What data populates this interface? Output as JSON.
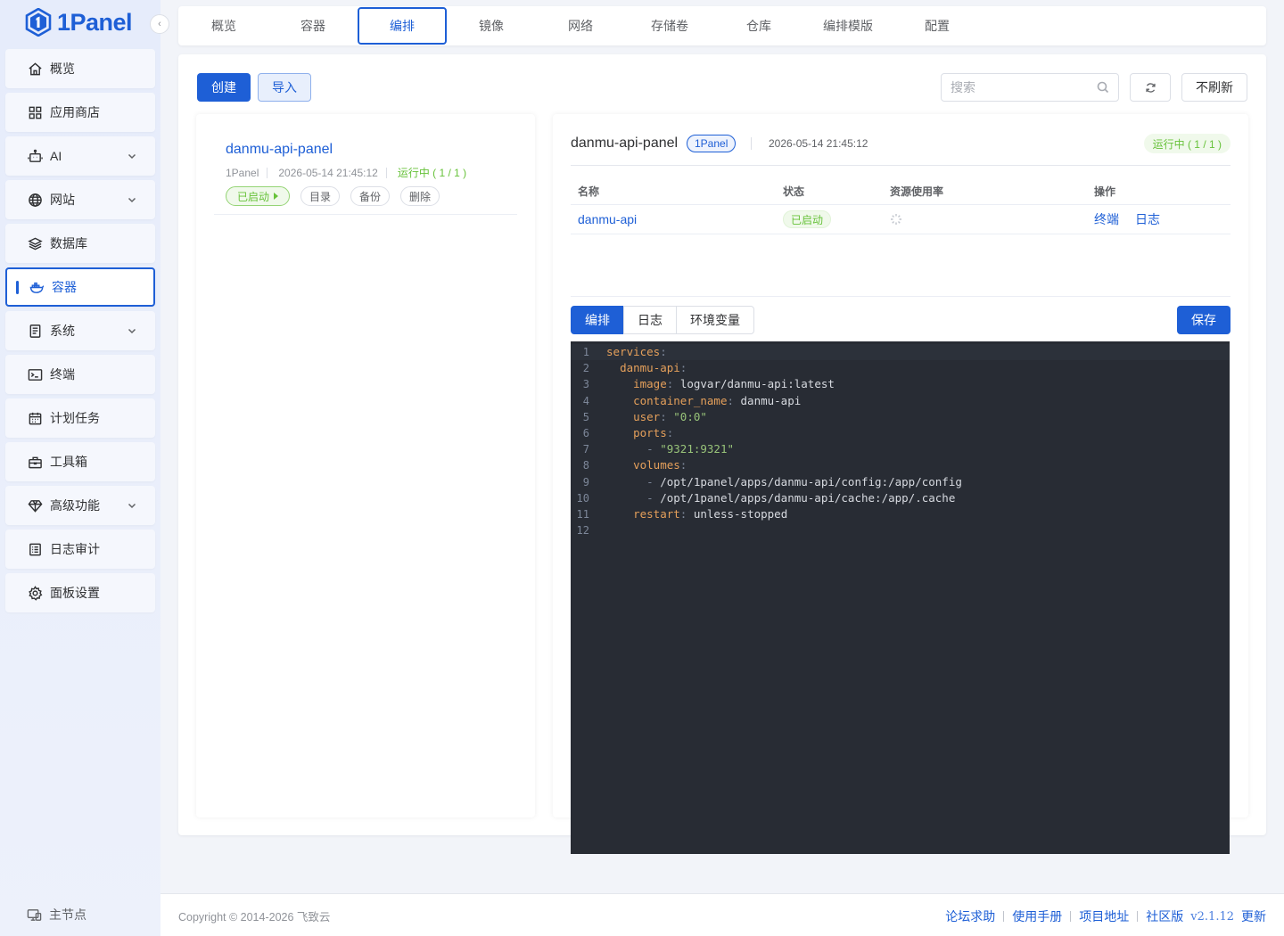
{
  "app": {
    "logo_text": "1Panel"
  },
  "sidebar": {
    "items": [
      {
        "label": "概览",
        "icon": "home-icon"
      },
      {
        "label": "应用商店",
        "icon": "grid-icon"
      },
      {
        "label": "AI",
        "icon": "robot-icon"
      },
      {
        "label": "网站",
        "icon": "globe-icon"
      },
      {
        "label": "数据库",
        "icon": "layers-icon"
      },
      {
        "label": "容器",
        "icon": "docker-icon"
      },
      {
        "label": "系统",
        "icon": "document-icon"
      },
      {
        "label": "终端",
        "icon": "terminal-icon"
      },
      {
        "label": "计划任务",
        "icon": "calendar-icon"
      },
      {
        "label": "工具箱",
        "icon": "toolbox-icon"
      },
      {
        "label": "高级功能",
        "icon": "diamond-icon"
      },
      {
        "label": "日志审计",
        "icon": "log-icon"
      },
      {
        "label": "面板设置",
        "icon": "gear-icon"
      }
    ],
    "footer_label": "主节点"
  },
  "top_tabs": [
    "概览",
    "容器",
    "编排",
    "镜像",
    "网络",
    "存储卷",
    "仓库",
    "编排模版",
    "配置"
  ],
  "toolbar": {
    "create_label": "创建",
    "import_label": "导入",
    "search_placeholder": "搜索",
    "no_refresh_label": "不刷新"
  },
  "project": {
    "name": "danmu-api-panel",
    "source": "1Panel",
    "created": "2026-05-14 21:45:12",
    "status": "运行中 ( 1 / 1 )",
    "actions": {
      "started": "已启动",
      "directory": "目录",
      "backup": "备份",
      "delete": "删除"
    }
  },
  "detail": {
    "title": "danmu-api-panel",
    "badge": "1Panel",
    "time": "2026-05-14 21:45:12",
    "status": "运行中 ( 1 / 1 )",
    "table": {
      "headers": [
        "名称",
        "状态",
        "资源使用率",
        "操作"
      ],
      "rows": [
        {
          "name": "danmu-api",
          "status": "已启动",
          "ops": [
            "终端",
            "日志"
          ]
        }
      ]
    },
    "tabs": [
      "编排",
      "日志",
      "环境变量"
    ],
    "save_label": "保存"
  },
  "editor": {
    "lines": [
      "services:",
      "  danmu-api:",
      "    image: logvar/danmu-api:latest",
      "    container_name: danmu-api",
      "    user: \"0:0\"",
      "    ports:",
      "      - \"9321:9321\"",
      "    volumes:",
      "      - /opt/1panel/apps/danmu-api/config:/app/config",
      "      - /opt/1panel/apps/danmu-api/cache:/app/.cache",
      "    restart: unless-stopped",
      ""
    ]
  },
  "footer": {
    "copyright": "Copyright © 2014-2026 飞致云",
    "links": [
      "论坛求助",
      "使用手册",
      "项目地址",
      "社区版"
    ],
    "version": "v2.1.12",
    "update_label": "更新"
  },
  "colors": {
    "accent": "#1e5fd6",
    "success": "#67c23a",
    "editor_bg": "#282c34"
  }
}
